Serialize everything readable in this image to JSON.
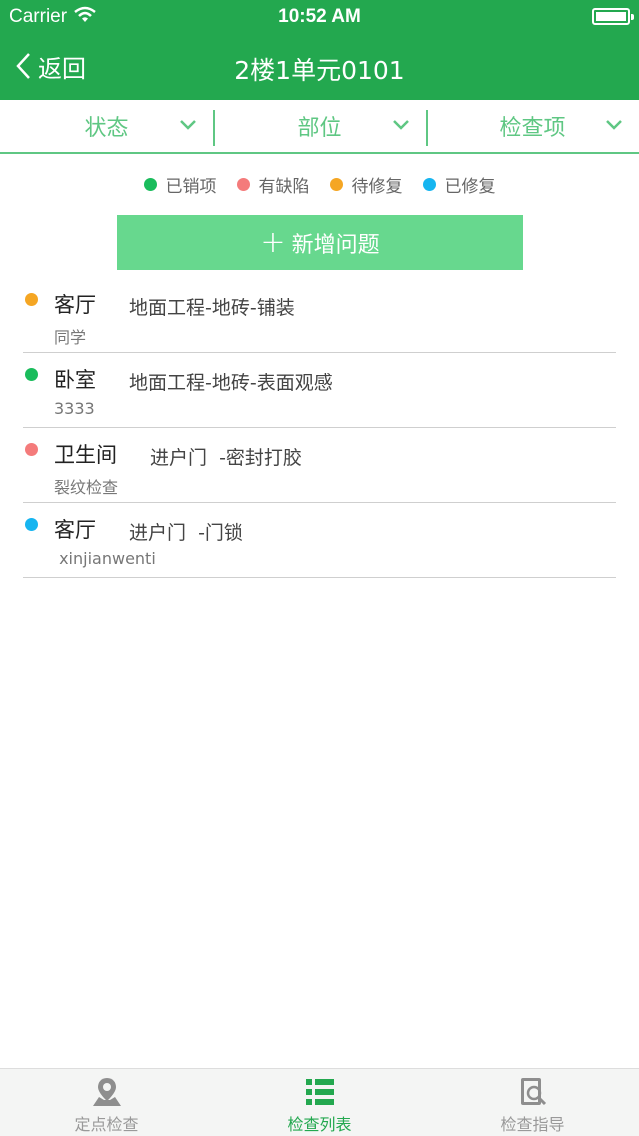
{
  "status_bar": {
    "carrier": "Carrier",
    "time": "10:52 AM"
  },
  "nav": {
    "back_label": "返回",
    "title": "2楼1单元0101"
  },
  "filters": [
    {
      "label": "状态"
    },
    {
      "label": "部位"
    },
    {
      "label": "检查项"
    }
  ],
  "legend": [
    {
      "label": "已销项",
      "color": "#1abc5c"
    },
    {
      "label": "有缺陷",
      "color": "#f47b7b"
    },
    {
      "label": "待修复",
      "color": "#f5a623"
    },
    {
      "label": "已修复",
      "color": "#16b5f0"
    }
  ],
  "add_button": {
    "label": "新增问题"
  },
  "issues": [
    {
      "room": "客厅",
      "item": "地面工程-地砖-铺装",
      "note": "同学",
      "status_color": "#f5a623"
    },
    {
      "room": "卧室",
      "item": "地面工程-地砖-表面观感",
      "note": "3333",
      "status_color": "#1abc5c"
    },
    {
      "room": "卫生间",
      "item": "进户门  -密封打胶",
      "note": "裂纹检查",
      "status_color": "#f47b7b"
    },
    {
      "room": "客厅",
      "item": "进户门  -门锁",
      "note": " xinjianwenti",
      "status_color": "#16b5f0"
    }
  ],
  "tabbar": [
    {
      "label": "定点检查",
      "icon": "location-pin-icon"
    },
    {
      "label": "检查列表",
      "icon": "list-icon",
      "active": true
    },
    {
      "label": "检查指导",
      "icon": "document-search-icon"
    }
  ],
  "colors": {
    "brand_green": "#23a84f",
    "filter_green": "#5fc783",
    "button_green": "#67d88e"
  }
}
